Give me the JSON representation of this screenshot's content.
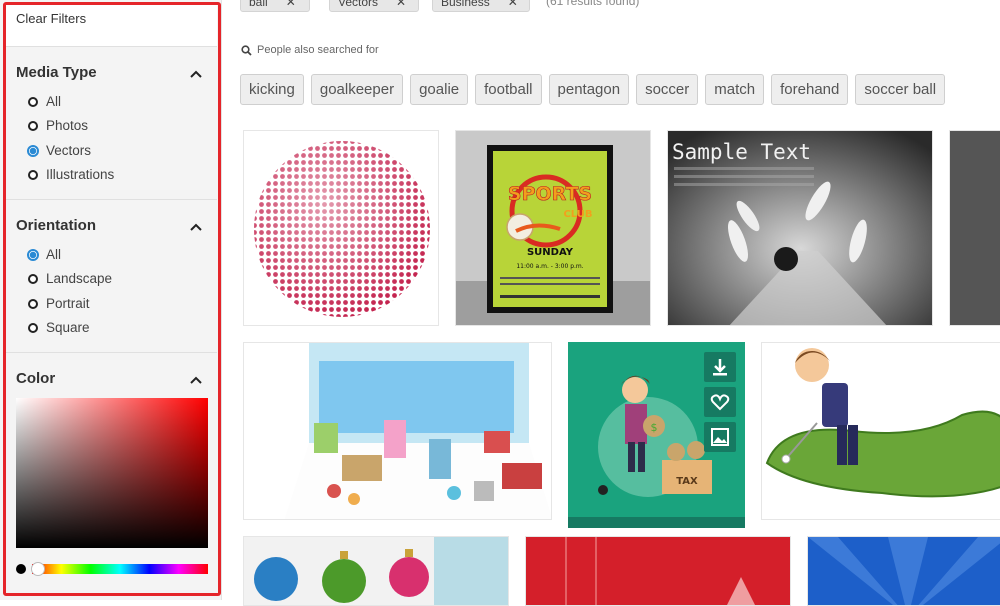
{
  "sidebar": {
    "clear_filters": "Clear Filters",
    "media_type": {
      "title": "Media Type",
      "options": [
        "All",
        "Photos",
        "Vectors",
        "Illustrations"
      ],
      "selected": "Vectors"
    },
    "orientation": {
      "title": "Orientation",
      "options": [
        "All",
        "Landscape",
        "Portrait",
        "Square"
      ],
      "selected": "All"
    },
    "color": {
      "title": "Color",
      "picker_base": "#ff0000"
    }
  },
  "active_filters": [
    "ball",
    "Vectors",
    "Business"
  ],
  "results_found": "(61 results found)",
  "people_also": {
    "label": "People also searched for",
    "tags": [
      "kicking",
      "goalkeeper",
      "goalie",
      "football",
      "pentagon",
      "soccer",
      "match",
      "forehand",
      "soccer ball"
    ]
  },
  "thumbs": {
    "sports_poster": {
      "title": "SPORTS",
      "subtitle": "CLUB",
      "day": "SUNDAY",
      "time": "11:00 a.m. - 3:00 p.m."
    },
    "bowling": {
      "title": "Sample Text"
    },
    "money": {
      "tax": "TAX"
    }
  },
  "colors": {
    "accent": "#2a8ad4",
    "highlight": "#e5252a",
    "teal": "#1aa37e"
  }
}
